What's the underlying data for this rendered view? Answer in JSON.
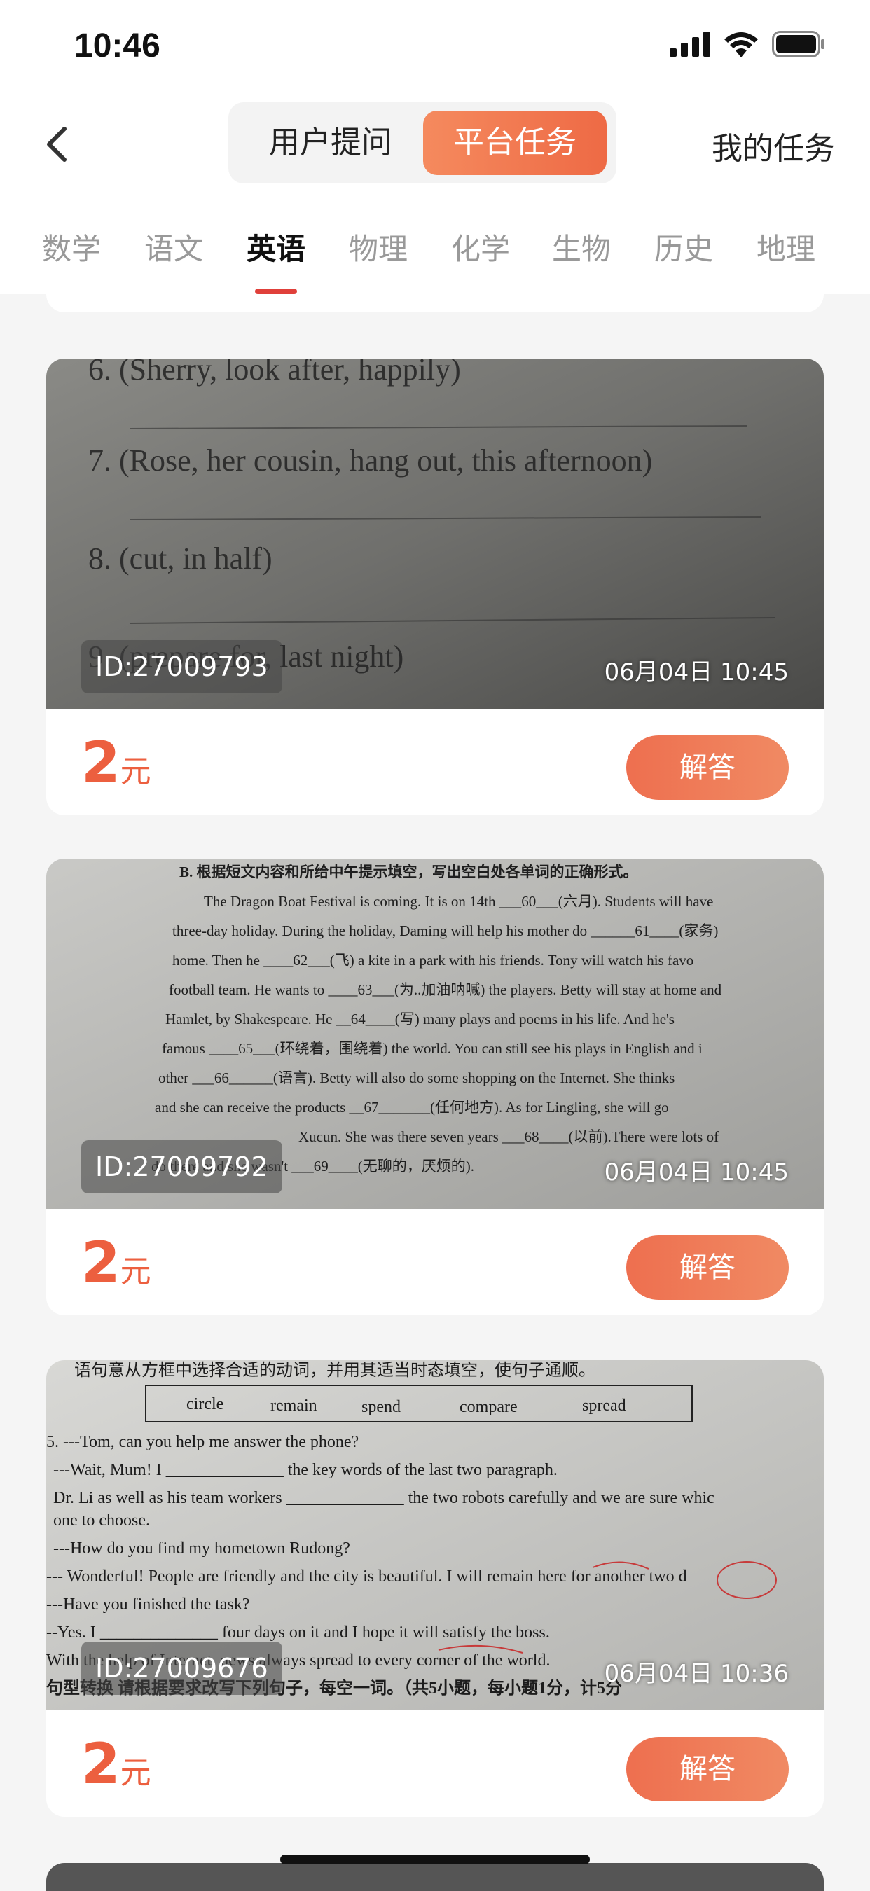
{
  "status_bar": {
    "time": "10:46"
  },
  "header": {
    "segments": [
      "用户提问",
      "平台任务"
    ],
    "active_segment": "平台任务",
    "my_tasks": "我的任务"
  },
  "tabs": {
    "items": [
      "数学",
      "语文",
      "英语",
      "物理",
      "化学",
      "生物",
      "历史",
      "地理"
    ],
    "active": "英语"
  },
  "tasks": [
    {
      "id": "ID:27009793",
      "time": "06月04日 10:45",
      "price_value": "2",
      "price_unit": "元",
      "answer_label": "解答",
      "photo_lines": [
        "6. (Sherry, look after, happily)",
        "7. (Rose, her cousin, hang out, this afternoon)",
        "8. (cut, in half)",
        "9. (prepare for, last night)"
      ]
    },
    {
      "id": "ID:27009792",
      "time": "06月04日 10:45",
      "price_value": "2",
      "price_unit": "元",
      "answer_label": "解答",
      "photo_lines": [
        "B. 根据短文内容和所给中午提示填空，写出空白处各单词的正确形式。",
        "The Dragon Boat Festival is coming. It is on 14th ___60___(六月). Students will have",
        "three-day holiday. During the holiday, Daming will help his mother do ______61____(家务)",
        "home. Then he ____62___(飞) a kite in a park with his friends. Tony will watch his favo",
        "football team. He wants to ____63___(为..加油呐喊) the players. Betty will stay at home and",
        "Hamlet, by Shakespeare. He __64____(写) many plays and poems in his life. And he's",
        "famous ____65___(环绕着，围绕着) the world. You can still see his plays in English and i",
        "other ___66______(语言). Betty will also do some shopping on the Internet. She thinks",
        "and she can receive the products __67_______(任何地方). As for Lingling, she will go",
        "Xucun. She was there seven years ___68____(以前).There were lots of",
        "do there and she wasn't ___69____(无聊的，厌烦的)."
      ]
    },
    {
      "id": "ID:27009676",
      "time": "06月04日 10:36",
      "price_value": "2",
      "price_unit": "元",
      "answer_label": "解答",
      "photo_words": [
        "circle",
        "remain",
        "spend",
        "compare",
        "spread"
      ],
      "photo_lines": [
        "语句意从方框中选择合适的动词，并用其适当时态填空，使句子通顺。",
        "5. ---Tom, can you help me answer the phone?",
        "---Wait, Mum! I ______________ the key words of the last two paragraph.",
        "Dr. Li as well as his team workers ______________ the two robots carefully and we are sure whic",
        "one to choose.",
        "---How do you find my hometown Rudong?",
        "--- Wonderful! People are friendly and the city is beautiful. I will remain here for another two d",
        "---Have you finished the task?",
        "--Yes. I ______________ four days on it and I hope it will satisfy the boss.",
        "With the help of Internet, news always spread to every corner of the world.",
        "句型转换   请根据要求改写下列句子，每空一词。（共5小题，每小题1分，计5分"
      ]
    }
  ]
}
